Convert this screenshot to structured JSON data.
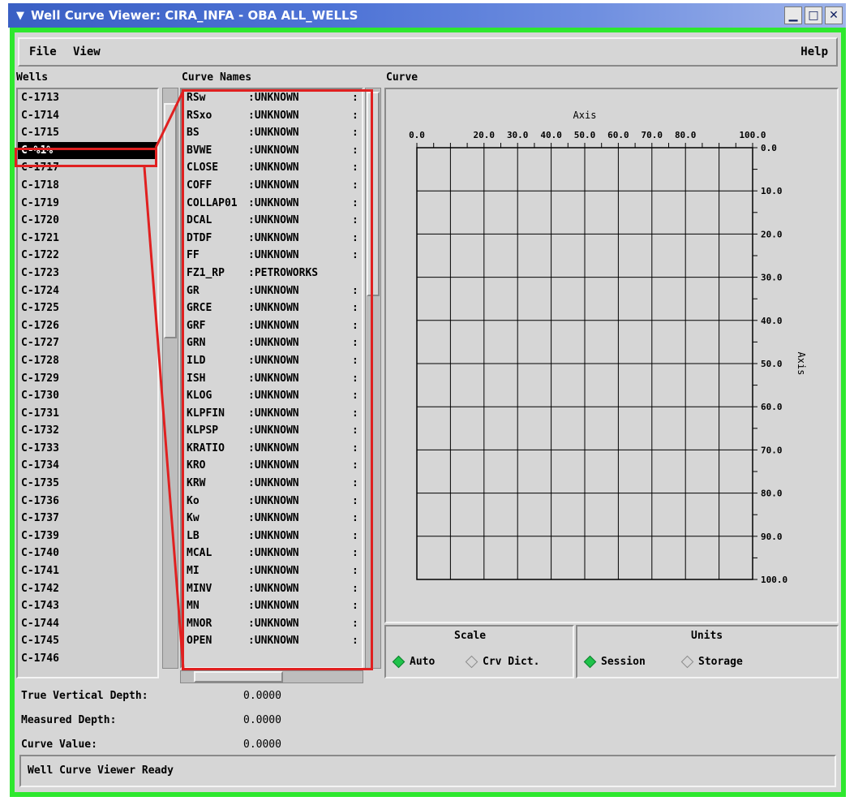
{
  "window": {
    "title": "Well Curve Viewer: CIRA_INFA - OBA ALL_WELLS",
    "minimize_glyph": "▁",
    "maximize_glyph": "□",
    "close_glyph": "✕"
  },
  "menu": {
    "file": "File",
    "view": "View",
    "help": "Help"
  },
  "wells": {
    "label": "Wells",
    "items": [
      "C-1713",
      "C-1714",
      "C-1715",
      "C-%1%",
      "C-1717",
      "C-1718",
      "C-1719",
      "C-1720",
      "C-1721",
      "C-1722",
      "C-1723",
      "C-1724",
      "C-1725",
      "C-1726",
      "C-1727",
      "C-1728",
      "C-1729",
      "C-1730",
      "C-1731",
      "C-1732",
      "C-1733",
      "C-1734",
      "C-1735",
      "C-1736",
      "C-1737",
      "C-1739",
      "C-1740",
      "C-1741",
      "C-1742",
      "C-1743",
      "C-1744",
      "C-1745",
      "C-1746"
    ],
    "selected_index": 3
  },
  "curves": {
    "label": "Curve Names",
    "items": [
      {
        "name": "RSw",
        "source": ":UNKNOWN"
      },
      {
        "name": "RSxo",
        "source": ":UNKNOWN"
      },
      {
        "name": "BS",
        "source": ":UNKNOWN"
      },
      {
        "name": "BVWE",
        "source": ":UNKNOWN"
      },
      {
        "name": "CLOSE",
        "source": ":UNKNOWN"
      },
      {
        "name": "COFF",
        "source": ":UNKNOWN"
      },
      {
        "name": "COLLAP01",
        "source": ":UNKNOWN"
      },
      {
        "name": "DCAL",
        "source": ":UNKNOWN"
      },
      {
        "name": "DTDF",
        "source": ":UNKNOWN"
      },
      {
        "name": "FF",
        "source": ":UNKNOWN"
      },
      {
        "name": "FZ1_RP",
        "source": ":PETROWORKS"
      },
      {
        "name": "GR",
        "source": ":UNKNOWN"
      },
      {
        "name": "GRCE",
        "source": ":UNKNOWN"
      },
      {
        "name": "GRF",
        "source": ":UNKNOWN"
      },
      {
        "name": "GRN",
        "source": ":UNKNOWN"
      },
      {
        "name": "ILD",
        "source": ":UNKNOWN"
      },
      {
        "name": "ISH",
        "source": ":UNKNOWN"
      },
      {
        "name": "KLOG",
        "source": ":UNKNOWN"
      },
      {
        "name": "KLPFIN",
        "source": ":UNKNOWN"
      },
      {
        "name": "KLPSP",
        "source": ":UNKNOWN"
      },
      {
        "name": "KRATIO",
        "source": ":UNKNOWN"
      },
      {
        "name": "KRO",
        "source": ":UNKNOWN"
      },
      {
        "name": "KRW",
        "source": ":UNKNOWN"
      },
      {
        "name": "Ko",
        "source": ":UNKNOWN"
      },
      {
        "name": "Kw",
        "source": ":UNKNOWN"
      },
      {
        "name": "LB",
        "source": ":UNKNOWN"
      },
      {
        "name": "MCAL",
        "source": ":UNKNOWN"
      },
      {
        "name": "MI",
        "source": ":UNKNOWN"
      },
      {
        "name": "MINV",
        "source": ":UNKNOWN"
      },
      {
        "name": "MN",
        "source": ":UNKNOWN"
      },
      {
        "name": "MNOR",
        "source": ":UNKNOWN"
      },
      {
        "name": "OPEN",
        "source": ":UNKNOWN"
      }
    ],
    "separator": ":"
  },
  "curve_panel": {
    "label": "Curve",
    "x_axis_title": "Axis",
    "y_axis_title": "Axis",
    "x_ticks": [
      "0.0",
      "20.0",
      "30.0",
      "40.0",
      "50.0",
      "60.0",
      "70.0",
      "80.0",
      "100.0"
    ],
    "y_ticks": [
      "0.0",
      "10.0",
      "20.0",
      "30.0",
      "40.0",
      "50.0",
      "60.0",
      "70.0",
      "80.0",
      "90.0",
      "100.0"
    ]
  },
  "scale": {
    "label": "Scale",
    "options": [
      "Auto",
      "Crv Dict."
    ],
    "selected": "Auto"
  },
  "units": {
    "label": "Units",
    "options": [
      "Session",
      "Storage"
    ],
    "selected": "Session"
  },
  "readouts": {
    "tvd_label": "True Vertical Depth:",
    "tvd_value": "0.0000",
    "md_label": "Measured Depth:",
    "md_value": "0.0000",
    "cv_label": "Curve Value:",
    "cv_value": "0.0000"
  },
  "status": {
    "message": "Well Curve Viewer Ready"
  },
  "colors": {
    "frame": "#2ee82e",
    "callout": "#e02020",
    "radio_on": "#1fc24a",
    "titlebar": "#3a5fc4"
  }
}
